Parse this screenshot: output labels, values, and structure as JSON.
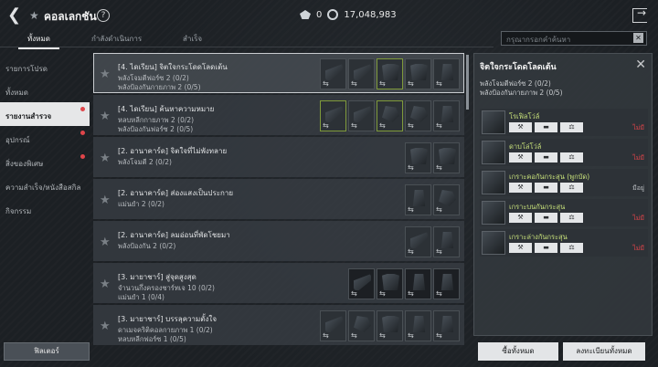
{
  "header": {
    "title": "คอลเลกชัน",
    "help": "?",
    "currency1": "0",
    "currency2": "17,048,983"
  },
  "tabs": [
    {
      "label": "ทั้งหมด"
    },
    {
      "label": "กำลังดำเนินการ"
    },
    {
      "label": "สำเร็จ"
    }
  ],
  "search": {
    "placeholder": "กรุณากรอกคำค้นหา",
    "clear": "✕"
  },
  "sidebar": {
    "items": [
      {
        "label": "รายการโปรด"
      },
      {
        "label": "ทั้งหมด"
      },
      {
        "label": "รายงานสำรวจ"
      },
      {
        "label": "อุปกรณ์"
      },
      {
        "label": "สิ่งของพิเศษ"
      },
      {
        "label": "ความสำเร็จ/หนังสือสกิล"
      },
      {
        "label": "กิจกรรม"
      }
    ],
    "filter_label": "ฟิลเตอร์"
  },
  "list": [
    {
      "name": "[4. ไดเรียน] จิตใจกระโดดโลดเต้น",
      "stat1": "พลังโจมตีฟอร์ซ 2 (0/2)",
      "stat2": "พลังป้องกันกายภาพ 2 (0/5)"
    },
    {
      "name": "[4. ไดเรียน] ค้นหาความหมาย",
      "stat1": "หลบหลีกกายภาพ 2 (0/2)",
      "stat2": "พลังป้องกันฟอร์ซ 2 (0/5)"
    },
    {
      "name": "[2. อานาคาร์ด] จิตใจที่ไม่พังทลาย",
      "stat1": "พลังโจมตี 2 (0/2)",
      "stat2": ""
    },
    {
      "name": "[2. อานาคาร์ด] ส่องแสงเป็นประกาย",
      "stat1": "แม่นยำ 2 (0/2)",
      "stat2": ""
    },
    {
      "name": "[2. อานาคาร์ด] ลมอ่อนที่พัดโชยมา",
      "stat1": "พลังป้องกัน 2 (0/2)",
      "stat2": ""
    },
    {
      "name": "[3. มายาชาร์] สู่จุดสูงสุด",
      "stat1": "จำนวนกึ่งครองชาร์ทเจ 10 (0/2)",
      "stat2": "แม่นยำ 1 (0/4)"
    },
    {
      "name": "[3. มายาชาร์] บรรลุความตั้งใจ",
      "stat1": "ดาเมจคริติคอลกายภาพ 1 (0/2)",
      "stat2": "หลบหลีกฟอร์ซ 1 (0/5)"
    }
  ],
  "detail": {
    "title": "จิตใจกระโดดโลดเต้น",
    "close": "✕",
    "stat1": "พลังโจมตีฟอร์ซ 2 (0/2)",
    "stat2": "พลังป้องกันกายภาพ 2 (0/5)",
    "items": [
      {
        "name": "โรเฟิลโว่ล์",
        "status": "ไม่มี"
      },
      {
        "name": "ดาบโล่โว่ล์",
        "status": "ไม่มี"
      },
      {
        "name": "เกราะคอกันกระสุน (พูกบัด)",
        "status": "มีอยู่"
      },
      {
        "name": "เกราะบนกันกระสุน",
        "status": "ไม่มี"
      },
      {
        "name": "เกราะล่างกันกระสุน",
        "status": "ไม่มี"
      }
    ],
    "action_icons": [
      "⚒",
      "▬",
      "⚖"
    ]
  },
  "buttons": {
    "buy_all": "ซื้อทั้งหมด",
    "register_all": "ลงทะเบียนทั้งหมด"
  }
}
